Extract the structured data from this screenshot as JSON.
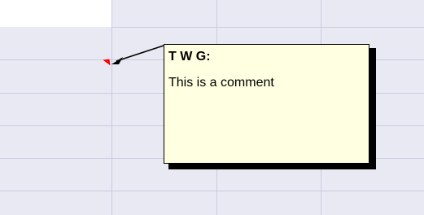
{
  "comment": {
    "author": "T W G:",
    "text": "This is a comment"
  },
  "colors": {
    "grid_background": "#e9e9f3",
    "grid_line": "#c9cbe0",
    "comment_background": "#ffffe1",
    "comment_indicator": "#ff0000",
    "shadow": "#000000"
  },
  "icons": {
    "comment_indicator": "comment-indicator-icon",
    "callout_arrow": "callout-arrow-icon"
  }
}
